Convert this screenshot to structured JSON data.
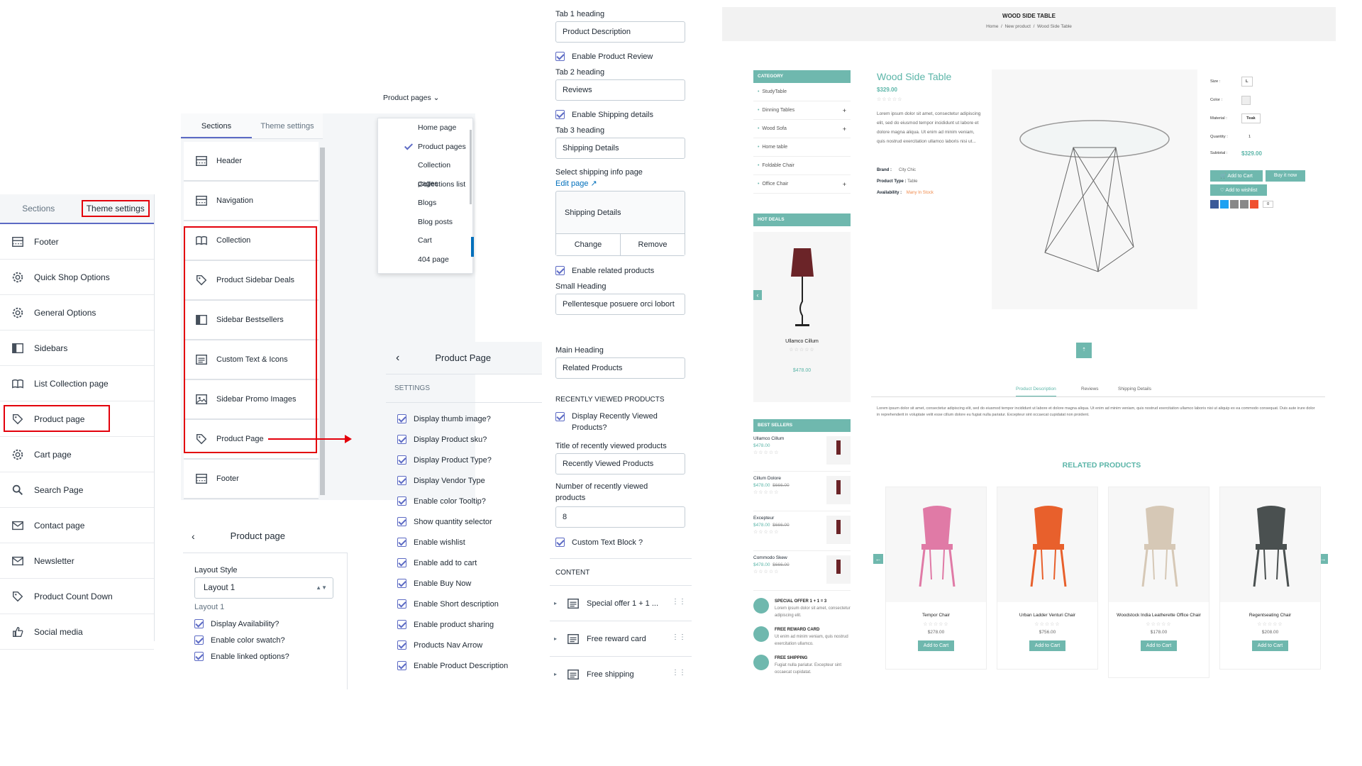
{
  "panel1": {
    "tabs": [
      "Sections",
      "Theme settings"
    ],
    "items": [
      {
        "label": "Footer",
        "icon": "grid-icon"
      },
      {
        "label": "Quick Shop Options",
        "icon": "gear-icon"
      },
      {
        "label": "General Options",
        "icon": "gear-icon"
      },
      {
        "label": "Sidebars",
        "icon": "sidebar-icon"
      },
      {
        "label": "List Collection page",
        "icon": "book-icon"
      },
      {
        "label": "Product page",
        "icon": "tag-icon"
      },
      {
        "label": "Cart page",
        "icon": "gear-icon"
      },
      {
        "label": "Search Page",
        "icon": "search-icon"
      },
      {
        "label": "Contact page",
        "icon": "mail-icon"
      },
      {
        "label": "Newsletter",
        "icon": "mail-icon"
      },
      {
        "label": "Product Count Down",
        "icon": "tag-icon"
      },
      {
        "label": "Social media",
        "icon": "thumb-icon"
      }
    ]
  },
  "panel2": {
    "page_select": "Product pages",
    "tabs": [
      "Sections",
      "Theme settings"
    ],
    "items": [
      "Header",
      "Navigation",
      "Collection",
      "Product Sidebar Deals",
      "Sidebar Bestsellers",
      "Custom Text & Icons",
      "Sidebar Promo Images",
      "Product Page",
      "Footer"
    ],
    "dropdown": [
      "Home page",
      "Product pages",
      "Collection pages",
      "Collections list",
      "Blogs",
      "Blog posts",
      "Cart",
      "404 page"
    ]
  },
  "panel3": {
    "title": "Product page",
    "layout_label": "Layout Style",
    "layout_value": "Layout 1",
    "layout_hint": "Layout 1",
    "checks": [
      "Display Availability?",
      "Enable color swatch?",
      "Enable linked options?"
    ]
  },
  "panel4": {
    "title": "Product Page",
    "section": "SETTINGS",
    "checks": [
      "Display thumb image?",
      "Display Product sku?",
      "Display Product Type?",
      "Display Vendor Type",
      "Enable color Tooltip?",
      "Show quantity selector",
      "Enable wishlist",
      "Enable add to cart",
      "Enable Buy Now",
      "Enable Short description",
      "Enable product sharing",
      "Products Nav Arrow",
      "Enable Product Description"
    ]
  },
  "panel5": {
    "tab1_label": "Tab 1 heading",
    "tab1_value": "Product Description",
    "review_check": "Enable Product Review",
    "tab2_label": "Tab 2 heading",
    "tab2_value": "Reviews",
    "shipping_check": "Enable Shipping details",
    "tab3_label": "Tab 3 heading",
    "tab3_value": "Shipping Details",
    "ship_page_label": "Select shipping info page",
    "edit_page": "Edit page",
    "ship_page_value": "Shipping Details",
    "change": "Change",
    "remove": "Remove",
    "related_check": "Enable related products",
    "small_heading_label": "Small Heading",
    "small_heading_value": "Pellentesque posuere orci lobort",
    "main_heading_label": "Main Heading",
    "main_heading_value": "Related Products",
    "recent_header": "RECENTLY VIEWED PRODUCTS",
    "recent_check": "Display Recently Viewed Products?",
    "recent_title_label": "Title of recently viewed products",
    "recent_title_value": "Recently Viewed Products",
    "recent_number_label": "Number of recently viewed products",
    "recent_number_value": "8",
    "custom_check": "Custom Text Block ?",
    "content_header": "CONTENT",
    "blocks": [
      "Special offer 1 + 1 ...",
      "Free reward card",
      "Free shipping"
    ]
  },
  "shop": {
    "page_title": "WOOD SIDE TABLE",
    "breadcrumb": [
      "Home",
      "New product",
      "Wood Side Table"
    ],
    "category_title": "CATEGORY",
    "categories": [
      {
        "name": "StudyTable",
        "plus": false
      },
      {
        "name": "Dinning Tables",
        "plus": true
      },
      {
        "name": "Wood Sofa",
        "plus": true
      },
      {
        "name": "Home table",
        "plus": false
      },
      {
        "name": "Foldable Chair",
        "plus": false
      },
      {
        "name": "Office Chair",
        "plus": true
      }
    ],
    "hot_deals_title": "HOT DEALS",
    "hot_deal": {
      "name": "Ullamco Cillum",
      "price": "$478.00"
    },
    "best_sellers_title": "BEST SELLERS",
    "best_sellers": [
      {
        "name": "Ullamco Cillum",
        "price": "$478.00",
        "old": ""
      },
      {
        "name": "Cillum Dolore",
        "price": "$478.00",
        "old": "$666.00"
      },
      {
        "name": "Excepteur",
        "price": "$478.00",
        "old": "$666.00"
      },
      {
        "name": "Commodo Skew",
        "price": "$478.00",
        "old": "$666.00"
      }
    ],
    "promos": [
      {
        "title": "SPECIAL OFFER 1 + 1 = 3",
        "text": "Lorem ipsum dolor sit amet, consectetur adipiscing elit."
      },
      {
        "title": "FREE REWARD CARD",
        "text": "Ut enim ad minim veniam, quis nostrud exercitation ullamco."
      },
      {
        "title": "FREE SHIPPING",
        "text": "Fugiat nulla pariatur. Excepteur sint occaecat cupidatat."
      }
    ],
    "product": {
      "name": "Wood Side Table",
      "price": "$329.00",
      "desc": "Lorem ipsum dolor sit amet, consectetur adipiscing elit, sed do eiusmod tempor incididunt ut labore et dolore magna aliqua. Ut enim ad minim veniam, quis nostrud exercitation ullamco laboris nisi ut...",
      "brand_label": "Brand :",
      "brand": "City Chic",
      "type_label": "Product Type :",
      "type": "Table",
      "avail_label": "Availability :",
      "avail": "Many In Stock"
    },
    "options": {
      "size_label": "Size :",
      "size": "L",
      "color_label": "Color :",
      "material_label": "Material :",
      "material": "Teak",
      "qty_label": "Quantity :",
      "qty": "1",
      "subtotal_label": "Subtotal :",
      "subtotal": "$329.00",
      "add_to_cart": "Add to Cart",
      "buy_now": "Buy it now",
      "wishlist": "Add to wishlist",
      "share_count": "0"
    },
    "tabs": [
      "Product Description",
      "Reviews",
      "Shipping Details"
    ],
    "tab_text": "Lorem ipsum dolor sit amet, consectetur adipiscing elit, sed do eiusmod tempor incididunt ut labore et dolore magna aliqua. Ut enim ad minim veniam, quis nostrud exercitation ullamco laboris nisi ut aliquip ex ea commodo consequat. Duis aute irure dolor in reprehenderit in voluptate velit esse cillum dolore eu fugiat nulla pariatur. Excepteur sint occaecat cupidatat non proident.",
    "related_title": "RELATED PRODUCTS",
    "related": [
      {
        "name": "Tempor Chair",
        "price": "$278.00",
        "color": "#e07aa6"
      },
      {
        "name": "Urban Ladder Venturi Chair",
        "price": "$756.00",
        "color": "#e8602c"
      },
      {
        "name": "Woodstock India Leatherette Office Chair",
        "price": "$178.00",
        "color": "#d6c8b6"
      },
      {
        "name": "Regentseating Chair",
        "price": "$208.00",
        "color": "#4a5050"
      }
    ],
    "add_to_cart_short": "Add to Cart"
  }
}
